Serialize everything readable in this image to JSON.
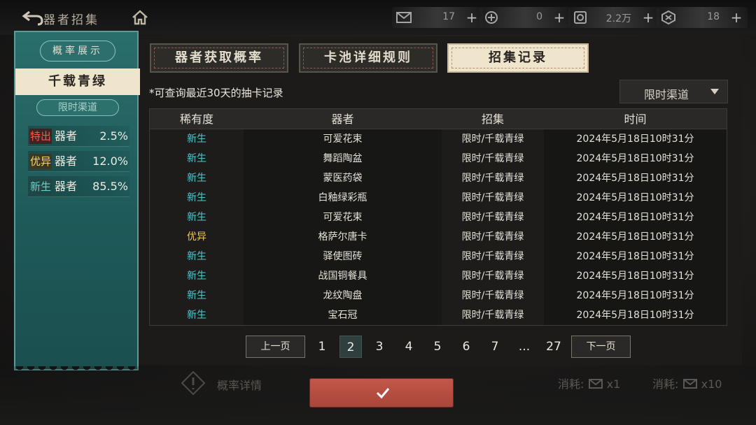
{
  "header": {
    "title": "器者招集",
    "resources": [
      {
        "icon": "envelope-ticket-icon",
        "value": "17"
      },
      {
        "icon": "coin-jar-icon",
        "value": "0"
      },
      {
        "icon": "token-icon",
        "value": "2.2万"
      },
      {
        "icon": "badge-icon",
        "value": "18"
      }
    ]
  },
  "left_card": {
    "heading": "概率展示",
    "pool_name": "千载青绿",
    "channel": "限时渠道",
    "rates": [
      {
        "tag": "特出",
        "label": "器者",
        "pct": "2.5%",
        "color": "#ff5449"
      },
      {
        "tag": "优异",
        "label": "器者",
        "pct": "12.0%",
        "color": "#f6d46a"
      },
      {
        "tag": "新生",
        "label": "器者",
        "pct": "85.5%",
        "color": "#5fd6d0"
      }
    ]
  },
  "tabs": [
    {
      "label": "器者获取概率",
      "active": false
    },
    {
      "label": "卡池详细规则",
      "active": false
    },
    {
      "label": "招集记录",
      "active": true
    }
  ],
  "records": {
    "note": "*可查询最近30天的抽卡记录",
    "filter": "限时渠道",
    "columns": [
      "稀有度",
      "器者",
      "招集",
      "时间"
    ],
    "rows": [
      {
        "rarity": "新生",
        "name": "可爱花束",
        "pool": "限时/千载青绿",
        "time": "2024年5月18日10时31分"
      },
      {
        "rarity": "新生",
        "name": "舞蹈陶盆",
        "pool": "限时/千载青绿",
        "time": "2024年5月18日10时31分"
      },
      {
        "rarity": "新生",
        "name": "蒙医药袋",
        "pool": "限时/千载青绿",
        "time": "2024年5月18日10时31分"
      },
      {
        "rarity": "新生",
        "name": "白釉绿彩瓶",
        "pool": "限时/千载青绿",
        "time": "2024年5月18日10时31分"
      },
      {
        "rarity": "新生",
        "name": "可爱花束",
        "pool": "限时/千载青绿",
        "time": "2024年5月18日10时31分"
      },
      {
        "rarity": "优异",
        "name": "格萨尔唐卡",
        "pool": "限时/千载青绿",
        "time": "2024年5月18日10时31分"
      },
      {
        "rarity": "新生",
        "name": "驿使图砖",
        "pool": "限时/千载青绿",
        "time": "2024年5月18日10时31分"
      },
      {
        "rarity": "新生",
        "name": "战国铜餐具",
        "pool": "限时/千载青绿",
        "time": "2024年5月18日10时31分"
      },
      {
        "rarity": "新生",
        "name": "龙纹陶盘",
        "pool": "限时/千载青绿",
        "time": "2024年5月18日10时31分"
      },
      {
        "rarity": "新生",
        "name": "宝石冠",
        "pool": "限时/千载青绿",
        "time": "2024年5月18日10时31分"
      }
    ]
  },
  "pagination": {
    "prev": "上一页",
    "next": "下一页",
    "pages": [
      "1",
      "2",
      "3",
      "4",
      "5",
      "6",
      "7",
      "...",
      "27"
    ],
    "current": "2"
  },
  "footer": {
    "probability_detail": "概率详情",
    "cost_single": "消耗:",
    "cost_single_qty": "x1",
    "cost_ten": "消耗:",
    "cost_ten_qty": "x10"
  }
}
